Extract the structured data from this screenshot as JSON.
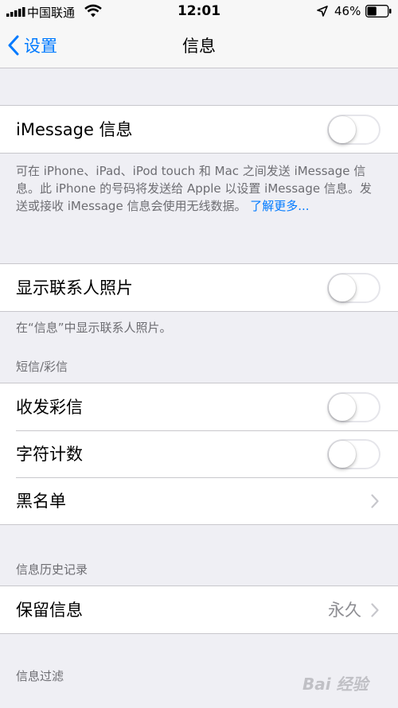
{
  "status_bar": {
    "carrier": "中国联通",
    "time": "12:01",
    "battery_percent": "46%",
    "battery_level": 0.46
  },
  "nav": {
    "back_label": "设置",
    "title": "信息"
  },
  "imessage": {
    "label": "iMessage 信息",
    "enabled": false,
    "footer": "可在 iPhone、iPad、iPod touch 和 Mac 之间发送 iMessage 信息。此 iPhone 的号码将发送给 Apple 以设置 iMessage 信息。发送或接收 iMessage 信息会使用无线数据。",
    "footer_link": "了解更多..."
  },
  "contact_photos": {
    "label": "显示联系人照片",
    "enabled": false,
    "footer": "在“信息”中显示联系人照片。"
  },
  "sms_mms": {
    "header": "短信/彩信",
    "mms_label": "收发彩信",
    "mms_enabled": false,
    "char_count_label": "字符计数",
    "char_count_enabled": false,
    "blacklist_label": "黑名单"
  },
  "history": {
    "header": "信息历史记录",
    "keep_label": "保留信息",
    "keep_value": "永久"
  },
  "filter": {
    "header": "信息过滤"
  },
  "watermark": "Bai 经验",
  "colors": {
    "accent": "#007aff",
    "background": "#efeff4",
    "secondary_text": "#6d6d72",
    "separator": "#c8c7cc"
  }
}
